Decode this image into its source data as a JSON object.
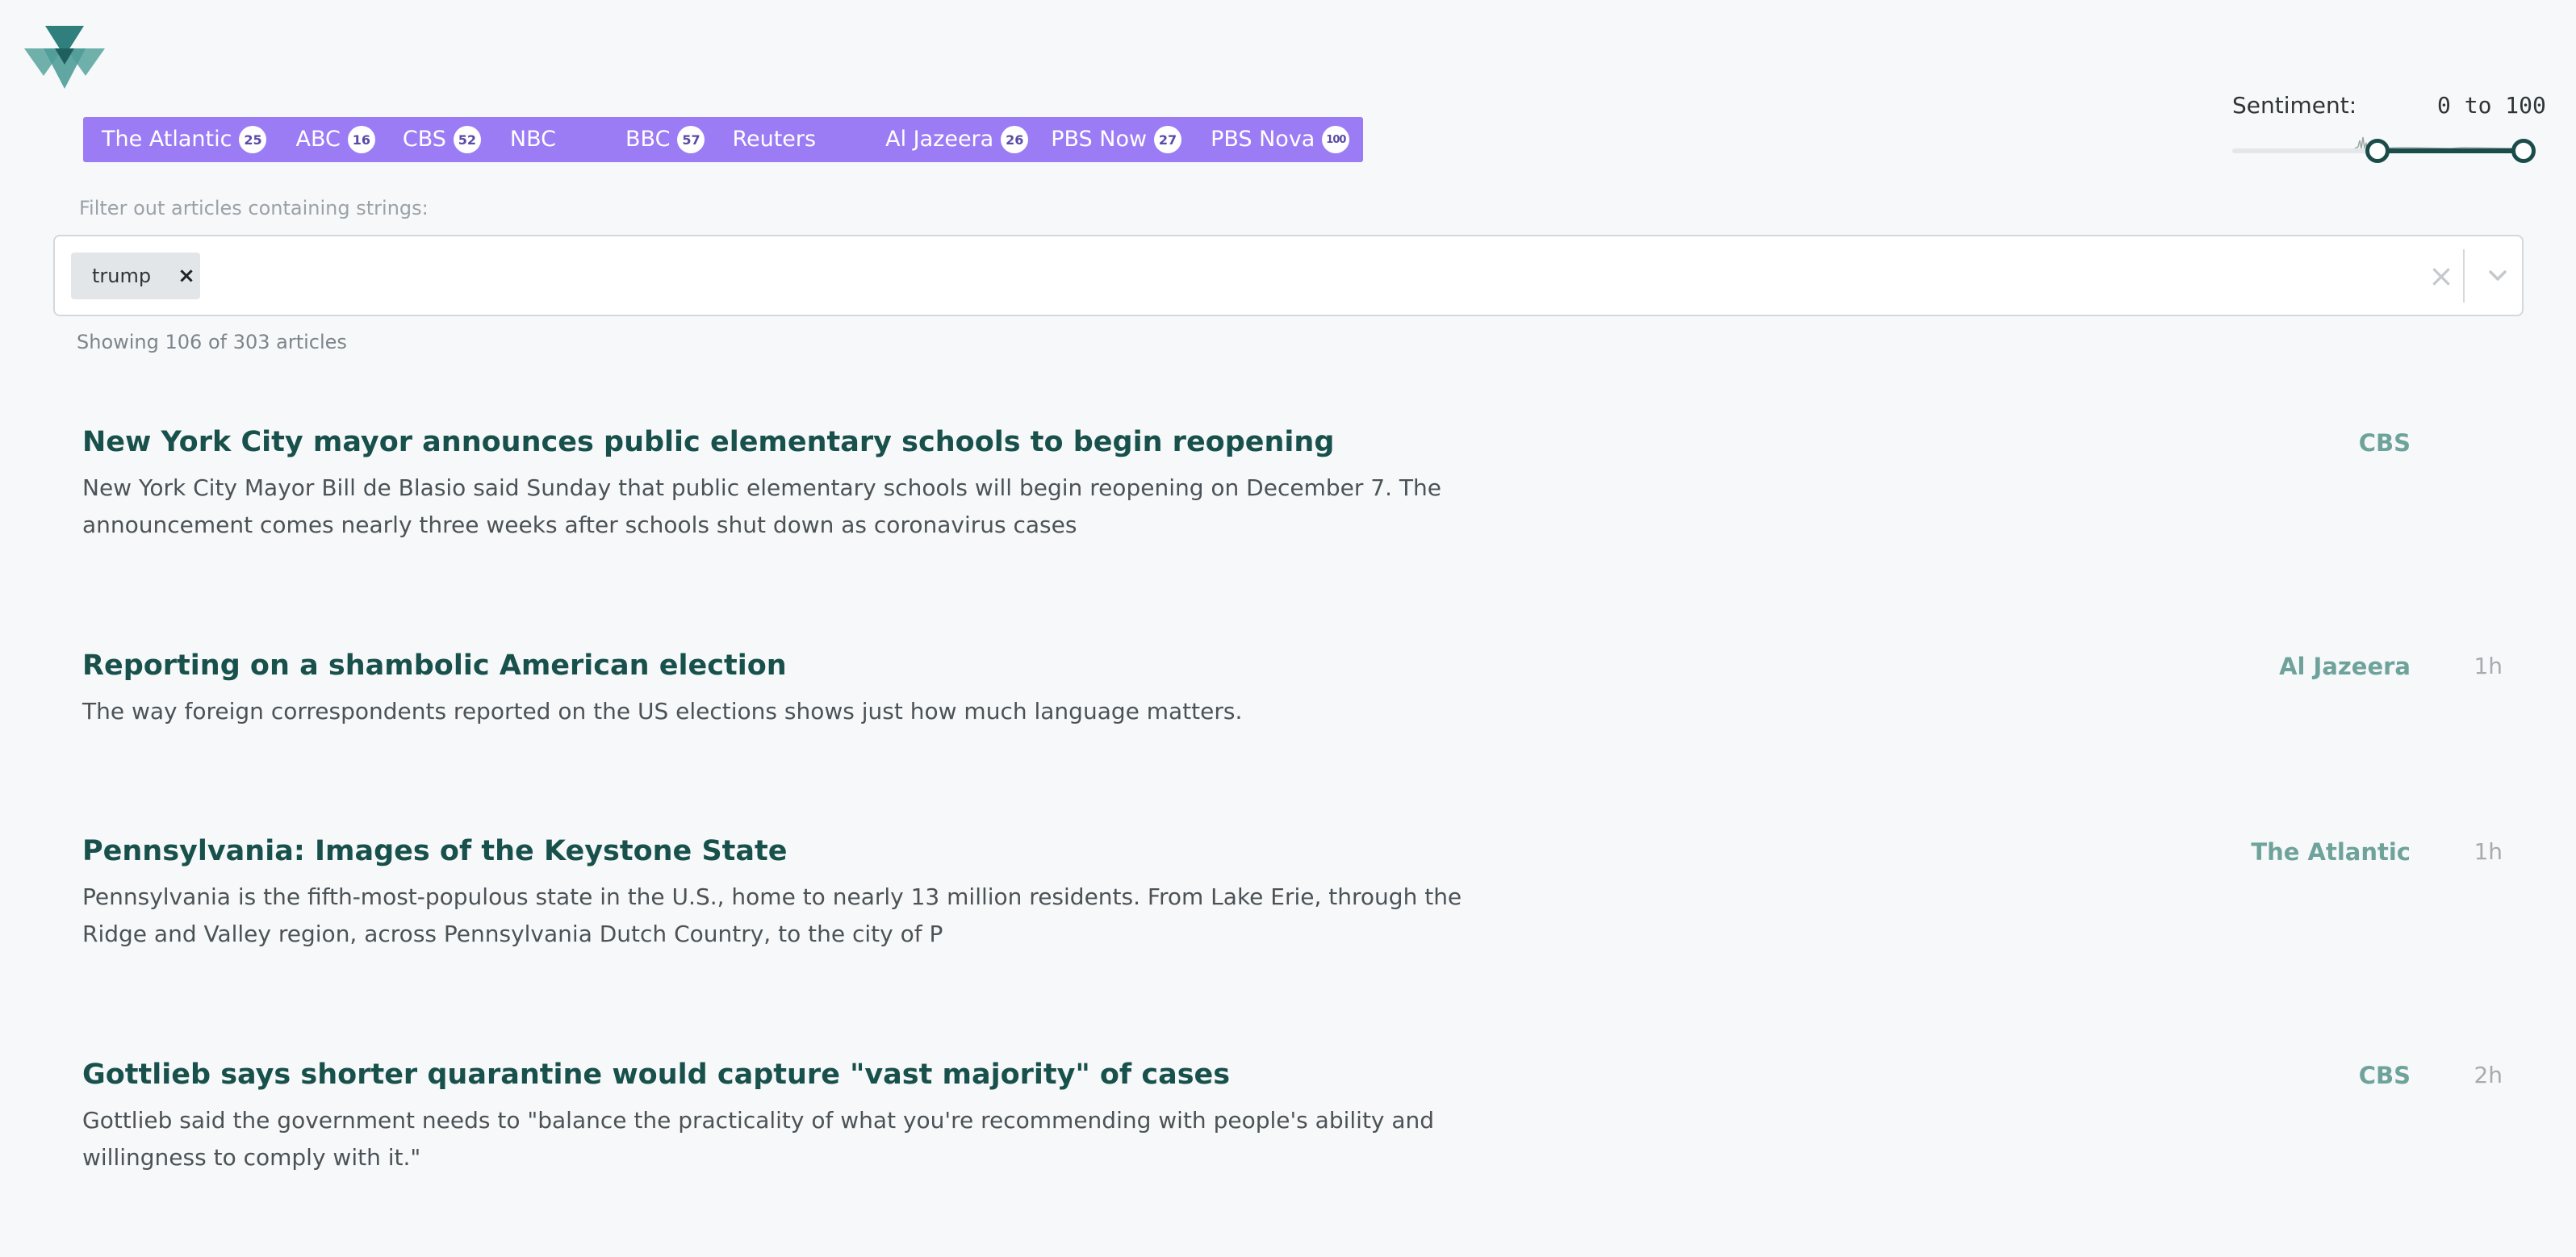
{
  "logo": {
    "icon": "triangle-logo-icon",
    "colors": [
      "#2e7c7a",
      "#4f9f9b",
      "#88c0bb"
    ]
  },
  "sources": [
    {
      "name": "The Atlantic",
      "count": "25"
    },
    {
      "name": "ABC",
      "count": "16"
    },
    {
      "name": "CBS",
      "count": "52"
    },
    {
      "name": "NBC",
      "count": ""
    },
    {
      "name": "BBC",
      "count": "57"
    },
    {
      "name": "Reuters",
      "count": ""
    },
    {
      "name": "Al Jazeera",
      "count": "26"
    },
    {
      "name": "PBS Now",
      "count": "27"
    },
    {
      "name": "PBS Nova",
      "count": "100"
    }
  ],
  "sentiment": {
    "label": "Sentiment:",
    "range": "0 to 100",
    "low": 0.5,
    "high": 1.0
  },
  "filter": {
    "label": "Filter out articles containing strings:",
    "tags": [
      "trump"
    ]
  },
  "count_text": "Showing 106 of 303 articles",
  "articles": [
    {
      "title": "New York City mayor announces public elementary schools to begin reopening",
      "summary": "New York City Mayor Bill de Blasio said Sunday that public elementary schools will begin reopening on December 7. The announcement comes nearly three weeks after schools shut down as coronavirus cases",
      "source": "CBS",
      "time": ""
    },
    {
      "title": "Reporting on a shambolic American election",
      "summary": "The way foreign correspondents reported on the US elections shows just how much language matters.",
      "source": "Al Jazeera",
      "time": "1h"
    },
    {
      "title": "Pennsylvania: Images of the Keystone State",
      "summary": "Pennsylvania is the fifth-most-populous state in the U.S., home to nearly 13 million residents. From Lake Erie, through the Ridge and Valley region, across Pennsylvania Dutch Country, to the city of P",
      "source": "The Atlantic",
      "time": "1h"
    },
    {
      "title": "Gottlieb says shorter quarantine would capture \"vast majority\" of cases",
      "summary": "Gottlieb said the government needs to \"balance the practicality of what you're recommending with people's ability and willingness to comply with it.\"",
      "source": "CBS",
      "time": "2h"
    }
  ],
  "colors": {
    "accent": "#9b7cf4",
    "title": "#18514b",
    "source": "#6ea39b",
    "slider": "#1a4d4a"
  }
}
